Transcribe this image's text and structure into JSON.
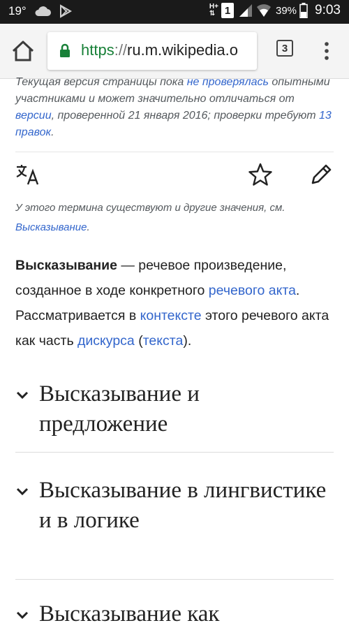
{
  "status_bar": {
    "temperature": "19°",
    "network_type": "H+",
    "sim": "1",
    "battery": "39%",
    "time": "9:03"
  },
  "browser": {
    "url_scheme": "https",
    "url_sep": "://",
    "url_host": "ru.m.wikipedia.o",
    "tab_count": "3",
    "accent_color": "#188038"
  },
  "notice": {
    "t1": "Текущая версия страницы пока ",
    "link1": "не проверялась",
    "t2": " опытными участниками и может значительно отличаться от ",
    "link2": "версии",
    "t3": ", проверенной 21 января 2016; проверки требуют ",
    "link3": "13 правок",
    "t4": "."
  },
  "page_actions": {
    "language_icon": "translate-icon",
    "watch_icon": "star-icon",
    "edit_icon": "pencil-icon"
  },
  "hatnote": {
    "text": "У этого термина существуют и другие значения, см. ",
    "link": "Высказывание",
    "end": "."
  },
  "lead": {
    "term": "Высказывание",
    "t1": " — речевое произведение, созданное в ходе конкретного ",
    "link1": "речевого акта",
    "t2": ". Рассматривается в ",
    "link2": "контексте",
    "t3": " этого речевого акта как часть ",
    "link3": "дискурса",
    "t4": " (",
    "link4": "текста",
    "t5": ")."
  },
  "sections": [
    {
      "title": "Высказывание и предложение"
    },
    {
      "title": "Высказывание в лингвистике и в логике"
    },
    {
      "title": "Высказывание как"
    }
  ]
}
